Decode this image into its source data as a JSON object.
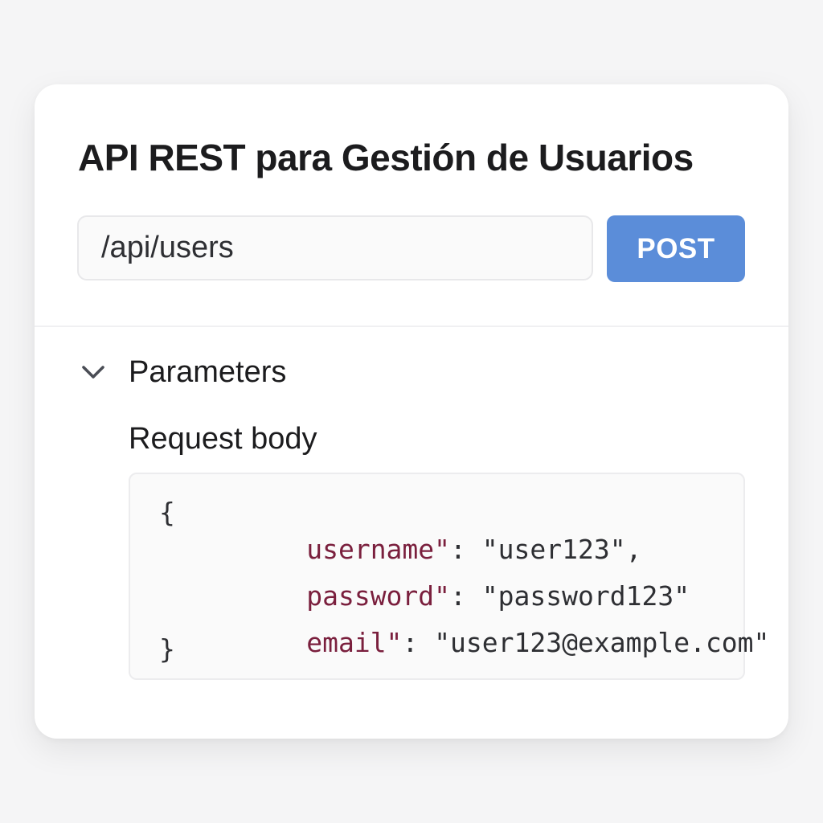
{
  "panel": {
    "title": "API REST para Gestión de Usuarios",
    "endpoint": {
      "path": "/api/users",
      "method": "POST",
      "method_color": "#5b8dd9"
    },
    "parameters": {
      "header_label": "Parameters",
      "expanded": true,
      "toggle_icon": "chevron-down-icon",
      "request_body_label": "Request body",
      "code": {
        "open_brace": "{",
        "close_brace": "}",
        "lines": [
          {
            "key": "username\"",
            "sep": ":",
            "value": "\"user123\","
          },
          {
            "key": "password\"",
            "sep": ":",
            "value": "\"password123\""
          },
          {
            "key": "email\"",
            "sep": ":",
            "value": "\"user123@example.com\""
          }
        ]
      }
    }
  }
}
